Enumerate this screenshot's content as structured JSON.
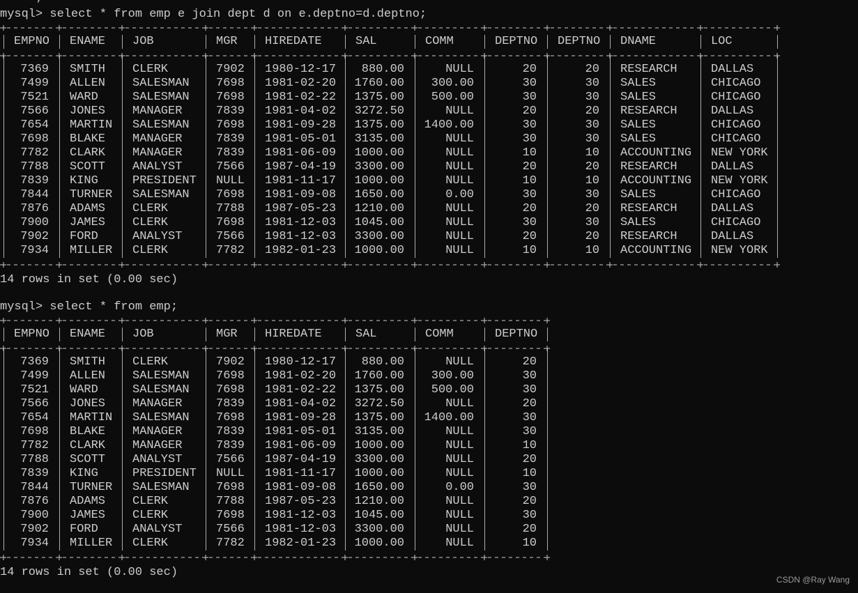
{
  "terminal": {
    "top_fragment": "  -> ;",
    "query1": "mysql> select * from emp e join dept d on e.deptno=d.deptno;",
    "query2": "mysql> select * from emp;",
    "summary1": "14 rows in set (0.00 sec)",
    "summary2": "14 rows in set (0.00 sec)",
    "watermark": "CSDN @Ray Wang"
  },
  "table1": {
    "headers": [
      "EMPNO",
      "ENAME",
      "JOB",
      "MGR",
      "HIREDATE",
      "SAL",
      "COMM",
      "DEPTNO",
      "DEPTNO",
      "DNAME",
      "LOC"
    ],
    "rows": [
      [
        "7369",
        "SMITH",
        "CLERK",
        "7902",
        "1980-12-17",
        "880.00",
        "NULL",
        "20",
        "20",
        "RESEARCH",
        "DALLAS"
      ],
      [
        "7499",
        "ALLEN",
        "SALESMAN",
        "7698",
        "1981-02-20",
        "1760.00",
        "300.00",
        "30",
        "30",
        "SALES",
        "CHICAGO"
      ],
      [
        "7521",
        "WARD",
        "SALESMAN",
        "7698",
        "1981-02-22",
        "1375.00",
        "500.00",
        "30",
        "30",
        "SALES",
        "CHICAGO"
      ],
      [
        "7566",
        "JONES",
        "MANAGER",
        "7839",
        "1981-04-02",
        "3272.50",
        "NULL",
        "20",
        "20",
        "RESEARCH",
        "DALLAS"
      ],
      [
        "7654",
        "MARTIN",
        "SALESMAN",
        "7698",
        "1981-09-28",
        "1375.00",
        "1400.00",
        "30",
        "30",
        "SALES",
        "CHICAGO"
      ],
      [
        "7698",
        "BLAKE",
        "MANAGER",
        "7839",
        "1981-05-01",
        "3135.00",
        "NULL",
        "30",
        "30",
        "SALES",
        "CHICAGO"
      ],
      [
        "7782",
        "CLARK",
        "MANAGER",
        "7839",
        "1981-06-09",
        "1000.00",
        "NULL",
        "10",
        "10",
        "ACCOUNTING",
        "NEW YORK"
      ],
      [
        "7788",
        "SCOTT",
        "ANALYST",
        "7566",
        "1987-04-19",
        "3300.00",
        "NULL",
        "20",
        "20",
        "RESEARCH",
        "DALLAS"
      ],
      [
        "7839",
        "KING",
        "PRESIDENT",
        "NULL",
        "1981-11-17",
        "1000.00",
        "NULL",
        "10",
        "10",
        "ACCOUNTING",
        "NEW YORK"
      ],
      [
        "7844",
        "TURNER",
        "SALESMAN",
        "7698",
        "1981-09-08",
        "1650.00",
        "0.00",
        "30",
        "30",
        "SALES",
        "CHICAGO"
      ],
      [
        "7876",
        "ADAMS",
        "CLERK",
        "7788",
        "1987-05-23",
        "1210.00",
        "NULL",
        "20",
        "20",
        "RESEARCH",
        "DALLAS"
      ],
      [
        "7900",
        "JAMES",
        "CLERK",
        "7698",
        "1981-12-03",
        "1045.00",
        "NULL",
        "30",
        "30",
        "SALES",
        "CHICAGO"
      ],
      [
        "7902",
        "FORD",
        "ANALYST",
        "7566",
        "1981-12-03",
        "3300.00",
        "NULL",
        "20",
        "20",
        "RESEARCH",
        "DALLAS"
      ],
      [
        "7934",
        "MILLER",
        "CLERK",
        "7782",
        "1982-01-23",
        "1000.00",
        "NULL",
        "10",
        "10",
        "ACCOUNTING",
        "NEW YORK"
      ]
    ]
  },
  "table2": {
    "headers": [
      "EMPNO",
      "ENAME",
      "JOB",
      "MGR",
      "HIREDATE",
      "SAL",
      "COMM",
      "DEPTNO"
    ],
    "rows": [
      [
        "7369",
        "SMITH",
        "CLERK",
        "7902",
        "1980-12-17",
        "880.00",
        "NULL",
        "20"
      ],
      [
        "7499",
        "ALLEN",
        "SALESMAN",
        "7698",
        "1981-02-20",
        "1760.00",
        "300.00",
        "30"
      ],
      [
        "7521",
        "WARD",
        "SALESMAN",
        "7698",
        "1981-02-22",
        "1375.00",
        "500.00",
        "30"
      ],
      [
        "7566",
        "JONES",
        "MANAGER",
        "7839",
        "1981-04-02",
        "3272.50",
        "NULL",
        "20"
      ],
      [
        "7654",
        "MARTIN",
        "SALESMAN",
        "7698",
        "1981-09-28",
        "1375.00",
        "1400.00",
        "30"
      ],
      [
        "7698",
        "BLAKE",
        "MANAGER",
        "7839",
        "1981-05-01",
        "3135.00",
        "NULL",
        "30"
      ],
      [
        "7782",
        "CLARK",
        "MANAGER",
        "7839",
        "1981-06-09",
        "1000.00",
        "NULL",
        "10"
      ],
      [
        "7788",
        "SCOTT",
        "ANALYST",
        "7566",
        "1987-04-19",
        "3300.00",
        "NULL",
        "20"
      ],
      [
        "7839",
        "KING",
        "PRESIDENT",
        "NULL",
        "1981-11-17",
        "1000.00",
        "NULL",
        "10"
      ],
      [
        "7844",
        "TURNER",
        "SALESMAN",
        "7698",
        "1981-09-08",
        "1650.00",
        "0.00",
        "30"
      ],
      [
        "7876",
        "ADAMS",
        "CLERK",
        "7788",
        "1987-05-23",
        "1210.00",
        "NULL",
        "20"
      ],
      [
        "7900",
        "JAMES",
        "CLERK",
        "7698",
        "1981-12-03",
        "1045.00",
        "NULL",
        "30"
      ],
      [
        "7902",
        "FORD",
        "ANALYST",
        "7566",
        "1981-12-03",
        "3300.00",
        "NULL",
        "20"
      ],
      [
        "7934",
        "MILLER",
        "CLERK",
        "7782",
        "1982-01-23",
        "1000.00",
        "NULL",
        "10"
      ]
    ]
  }
}
